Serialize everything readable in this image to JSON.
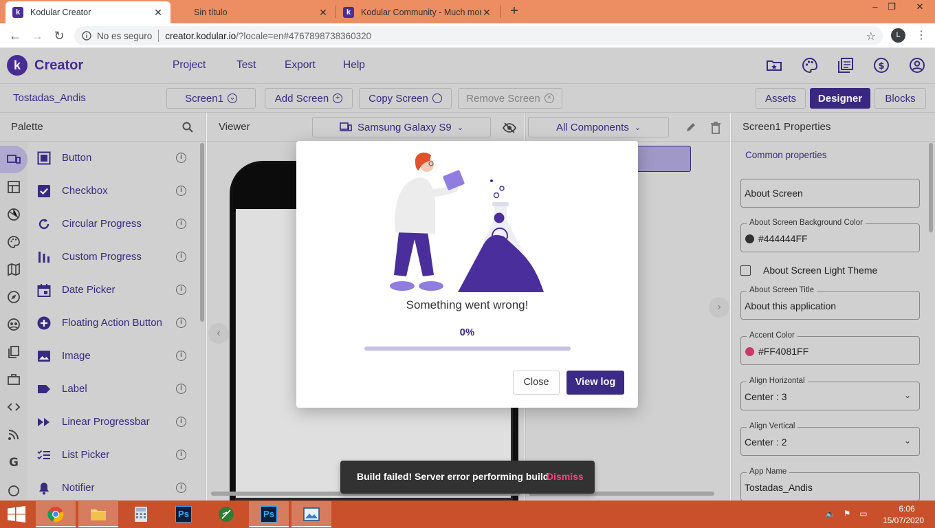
{
  "browser": {
    "tabs": [
      {
        "title": "Kodular Creator",
        "active": true
      },
      {
        "title": "Sin título",
        "active": false
      },
      {
        "title": "Kodular Community - Much mor",
        "active": false
      }
    ],
    "security_label": "No es seguro",
    "url_host": "creator.kodular.io",
    "url_path": "/?locale=en#4767898738360320",
    "profile_initial": "L"
  },
  "app": {
    "brand": "Creator",
    "menu": [
      "Project",
      "Test",
      "Export",
      "Help"
    ],
    "header_icons": [
      "folder-star-icon",
      "palette-icon",
      "library-icon",
      "dollar-icon",
      "account-icon"
    ]
  },
  "toolbar": {
    "project_name": "Tostadas_Andis",
    "screen_select": "Screen1",
    "add_screen": "Add Screen",
    "copy_screen": "Copy Screen",
    "remove_screen": "Remove Screen",
    "assets": "Assets",
    "designer": "Designer",
    "blocks": "Blocks"
  },
  "palette": {
    "title": "Palette",
    "items": [
      {
        "label": "Button",
        "icon": "button-icon"
      },
      {
        "label": "Checkbox",
        "icon": "checkbox-icon"
      },
      {
        "label": "Circular Progress",
        "icon": "circular-progress-icon"
      },
      {
        "label": "Custom Progress",
        "icon": "custom-progress-icon"
      },
      {
        "label": "Date Picker",
        "icon": "date-picker-icon"
      },
      {
        "label": "Floating Action Button",
        "icon": "fab-icon"
      },
      {
        "label": "Image",
        "icon": "image-icon"
      },
      {
        "label": "Label",
        "icon": "label-icon"
      },
      {
        "label": "Linear Progressbar",
        "icon": "linear-progress-icon"
      },
      {
        "label": "List Picker",
        "icon": "list-picker-icon"
      },
      {
        "label": "Notifier",
        "icon": "notifier-icon"
      }
    ],
    "info_glyph": "i"
  },
  "viewer": {
    "title": "Viewer",
    "device": "Samsung Galaxy S9"
  },
  "components": {
    "filter": "All Components"
  },
  "properties": {
    "title": "Screen1 Properties",
    "section": "Common properties",
    "about_screen": "About Screen",
    "bg_color_label": "About Screen Background Color",
    "bg_color_value": "#444444FF",
    "bg_color_hex": "#333333",
    "light_theme_label": "About Screen Light Theme",
    "title_label": "About Screen Title",
    "title_value": "About this application",
    "accent_label": "Accent Color",
    "accent_value": "#FF4081FF",
    "accent_hex": "#d63a6c",
    "align_h_label": "Align Horizontal",
    "align_h_value": "Center : 3",
    "align_v_label": "Align Vertical",
    "align_v_value": "Center : 2",
    "app_name_label": "App Name",
    "app_name_value": "Tostadas_Andis"
  },
  "modal": {
    "message": "Something went wrong!",
    "percent": "0%",
    "progress_fraction": 0,
    "close": "Close",
    "view_log": "View log"
  },
  "snackbar": {
    "message": "Build failed! Server error performing build",
    "action": "Dismiss"
  },
  "taskbar": {
    "time": "6:06",
    "date": "15/07/2020",
    "ps_label": "Ps"
  },
  "colors": {
    "brand": "#4a2e9c",
    "primary_button": "#3b2a86",
    "chrome_tabbar": "#ec8d62",
    "taskbar": "#c9502a",
    "snackbar_action": "#ff4081"
  }
}
